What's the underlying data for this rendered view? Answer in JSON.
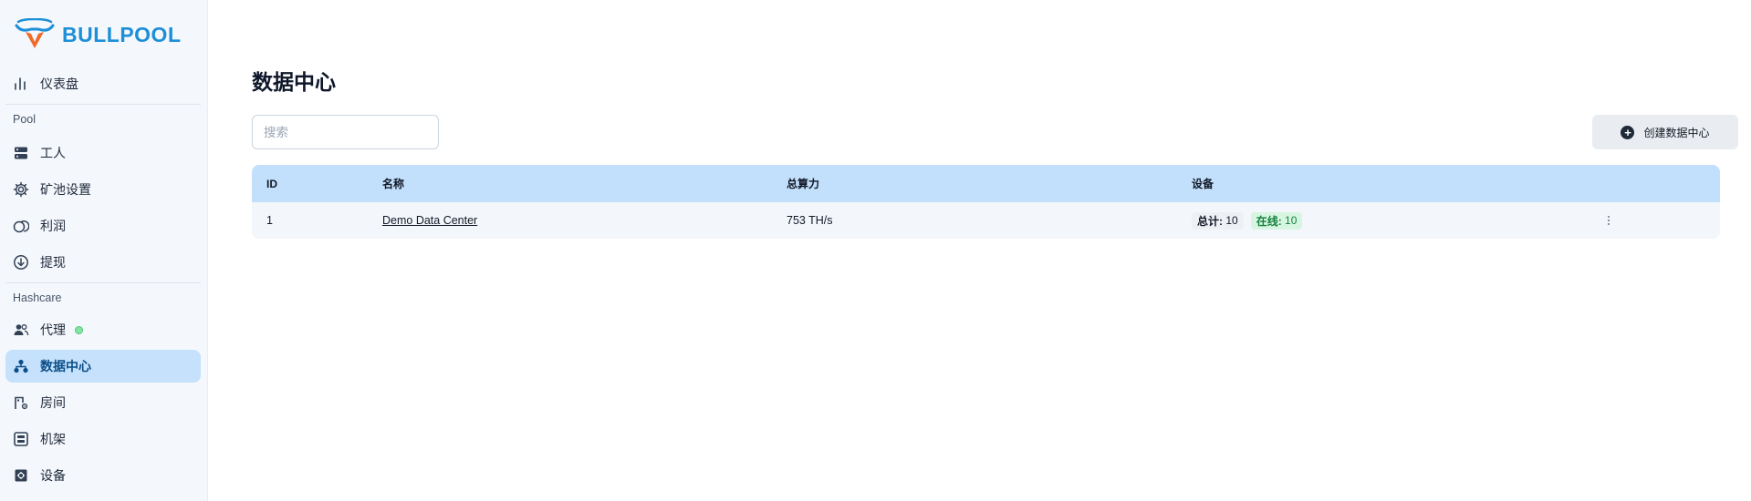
{
  "brand": {
    "name": "BULLPOOL"
  },
  "sidebar": {
    "items": [
      {
        "label": "仪表盘",
        "icon": "bar-chart-icon"
      },
      {
        "label": "工人",
        "icon": "server-icon"
      },
      {
        "label": "矿池设置",
        "icon": "gear-icon"
      },
      {
        "label": "利润",
        "icon": "coins-icon"
      },
      {
        "label": "提现",
        "icon": "download-circle-icon"
      },
      {
        "label": "代理",
        "icon": "users-icon",
        "status": "online"
      },
      {
        "label": "数据中心",
        "icon": "hierarchy-icon",
        "active": true
      },
      {
        "label": "房间",
        "icon": "building-gear-icon"
      },
      {
        "label": "机架",
        "icon": "rack-icon"
      },
      {
        "label": "设备",
        "icon": "chip-icon"
      }
    ],
    "sections": {
      "pool": "Pool",
      "hashcare": "Hashcare"
    }
  },
  "main": {
    "title": "数据中心",
    "search": {
      "placeholder": "搜索",
      "value": ""
    },
    "create_button": "创建数据中心"
  },
  "table": {
    "headers": [
      "ID",
      "名称",
      "总算力",
      "设备"
    ],
    "rows": [
      {
        "id": "1",
        "name": "Demo Data Center",
        "hashrate": "753 TH/s",
        "total_label": "总计:",
        "total": "10",
        "online_label": "在线:",
        "online": "10"
      }
    ]
  },
  "colors": {
    "accent": "#1d8fd8",
    "active_bg": "#c6e1fb",
    "header_bg": "#c2e0fb",
    "online": "#15803d"
  }
}
